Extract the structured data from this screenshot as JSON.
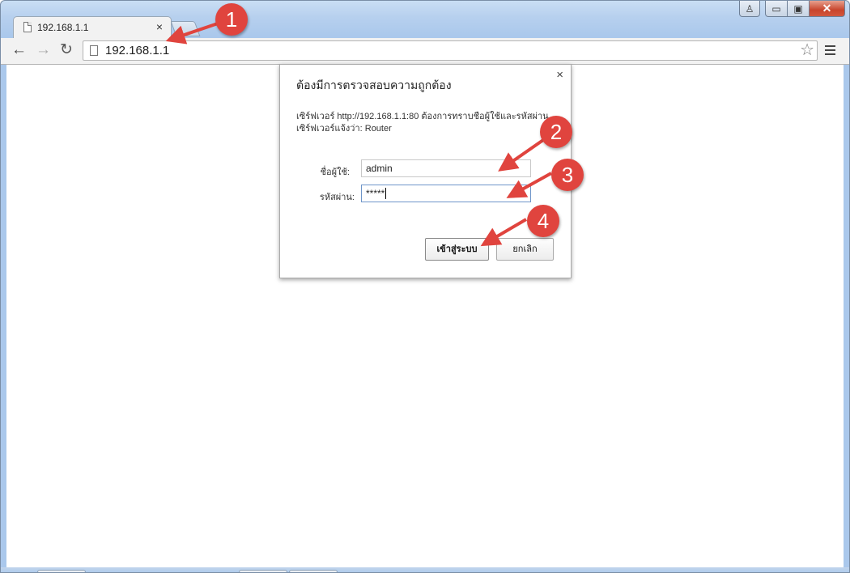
{
  "browser": {
    "tab_title": "192.168.1.1",
    "tab_close": "×",
    "url": "192.168.1.1",
    "nav_back": "←",
    "nav_forward": "→",
    "nav_reload": "↻",
    "bookmark_star": "☆"
  },
  "window_controls": {
    "user": "♙",
    "minimize": "▭",
    "maximize": "▣",
    "close": "✕"
  },
  "dialog": {
    "title": "ต้องมีการตรวจสอบความถูกต้อง",
    "close": "×",
    "message_line1": "เซิร์ฟเวอร์ http://192.168.1.1:80 ต้องการทราบชื่อผู้ใช้และรหัสผ่าน",
    "message_line2": "เซิร์ฟเวอร์แจ้งว่า: Router",
    "username_label": "ชื่อผู้ใช้:",
    "username_value": "admin",
    "password_label": "รหัสผ่าน:",
    "password_value": "*****",
    "login_button": "เข้าสู่ระบบ",
    "cancel_button": "ยกเลิก"
  },
  "annotations": {
    "step1": "1",
    "step2": "2",
    "step3": "3",
    "step4": "4",
    "color": "#e0443e"
  }
}
